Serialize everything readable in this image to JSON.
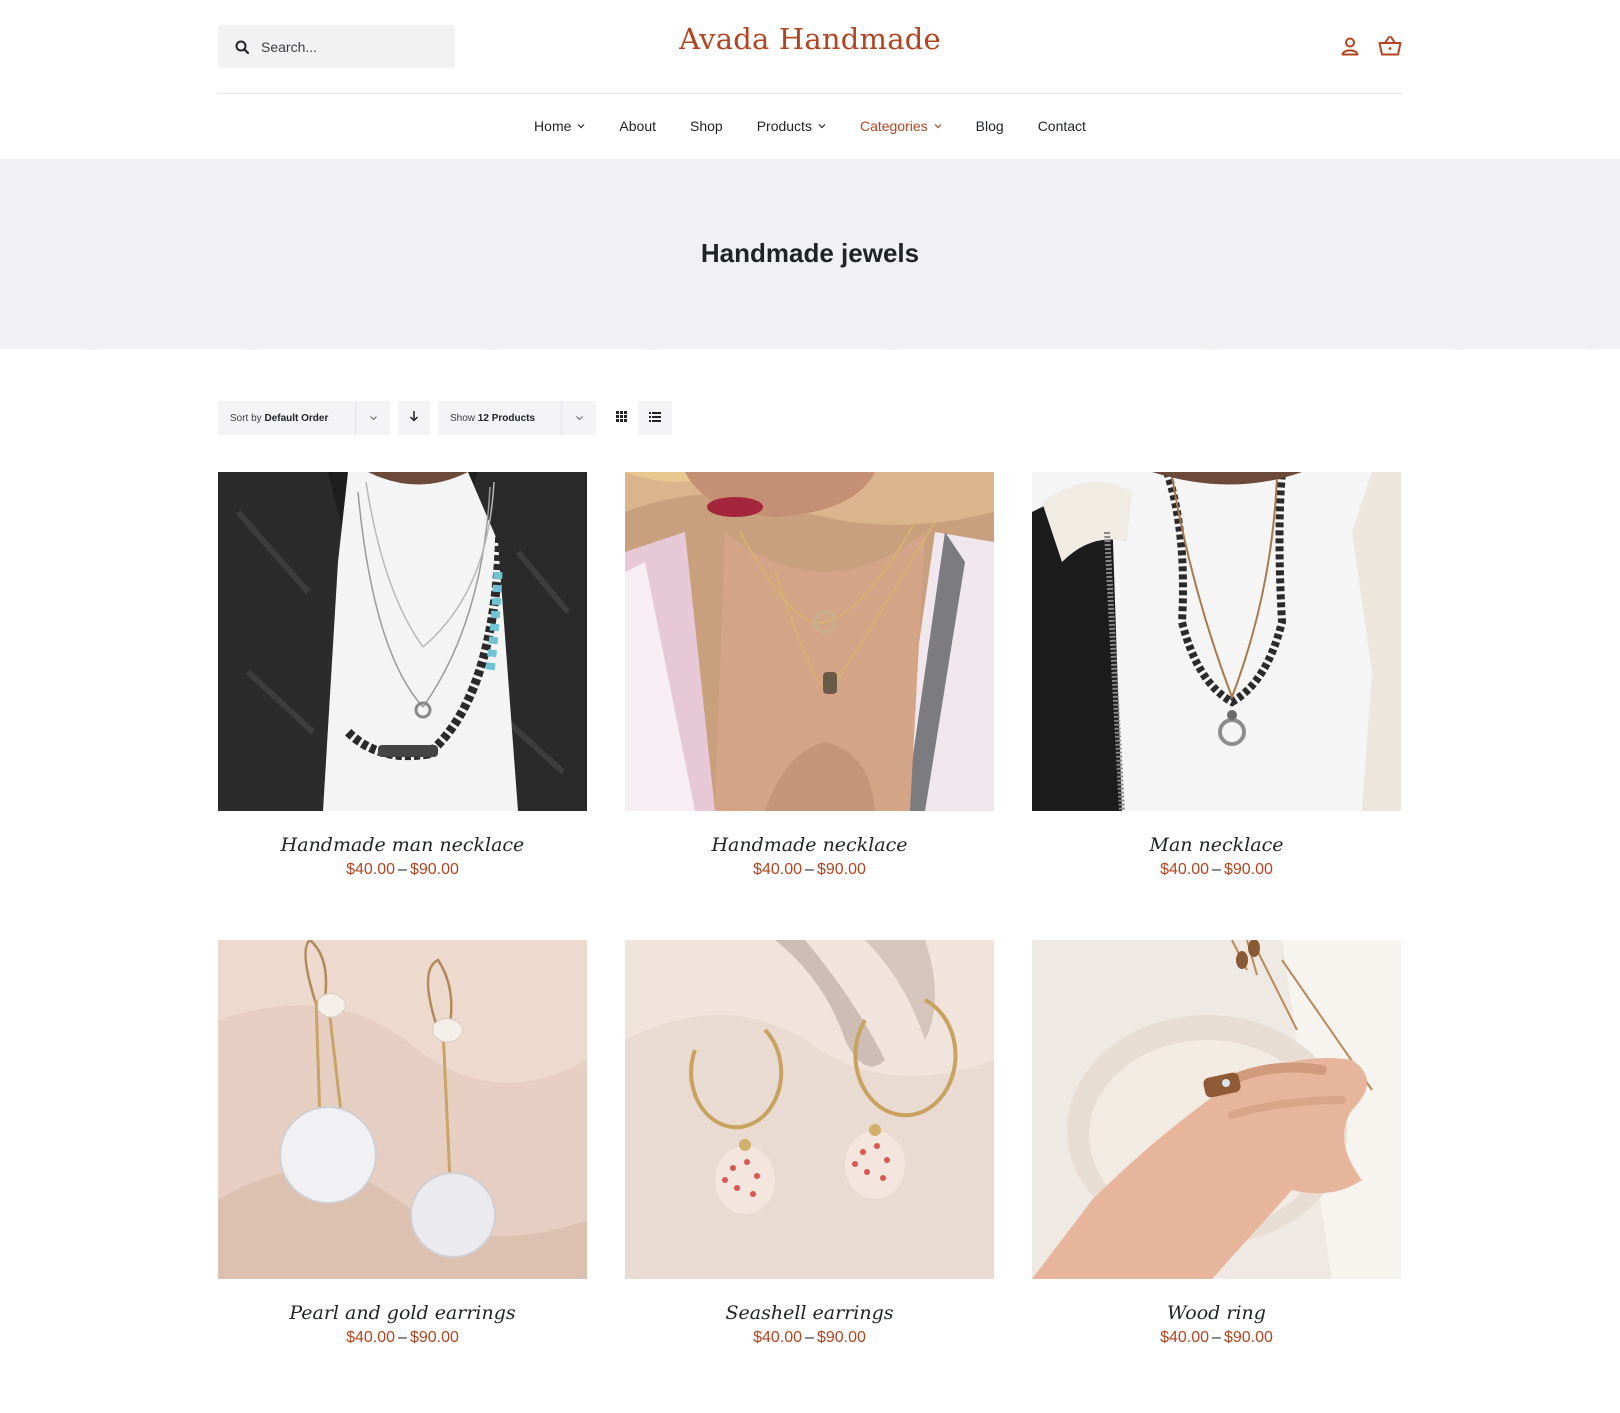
{
  "header": {
    "search_placeholder": "Search...",
    "logo": "Avada Handmade",
    "icons": [
      "user-icon",
      "basket-icon"
    ]
  },
  "nav": {
    "items": [
      {
        "label": "Home",
        "dropdown": true
      },
      {
        "label": "About",
        "dropdown": false
      },
      {
        "label": "Shop",
        "dropdown": false
      },
      {
        "label": "Products",
        "dropdown": true
      },
      {
        "label": "Categories",
        "dropdown": true,
        "active": true
      },
      {
        "label": "Blog",
        "dropdown": false
      },
      {
        "label": "Contact",
        "dropdown": false
      }
    ]
  },
  "page": {
    "title": "Handmade jewels"
  },
  "toolbar": {
    "sort_prefix": "Sort by",
    "sort_value": "Default Order",
    "show_prefix": "Show",
    "show_value": "12 Products"
  },
  "products": [
    {
      "name": "Handmade man necklace",
      "price_min": "$40.00",
      "price_sep": "–",
      "price_max": "$90.00"
    },
    {
      "name": "Handmade necklace",
      "price_min": "$40.00",
      "price_sep": "–",
      "price_max": "$90.00"
    },
    {
      "name": "Man necklace",
      "price_min": "$40.00",
      "price_sep": "–",
      "price_max": "$90.00"
    },
    {
      "name": "Pearl and gold earrings",
      "price_min": "$40.00",
      "price_sep": "–",
      "price_max": "$90.00"
    },
    {
      "name": "Seashell earrings",
      "price_min": "$40.00",
      "price_sep": "–",
      "price_max": "$90.00"
    },
    {
      "name": "Wood ring",
      "price_min": "$40.00",
      "price_sep": "–",
      "price_max": "$90.00"
    }
  ],
  "colors": {
    "accent": "#b3441f",
    "text": "#212326",
    "band": "#f1f1f4"
  }
}
